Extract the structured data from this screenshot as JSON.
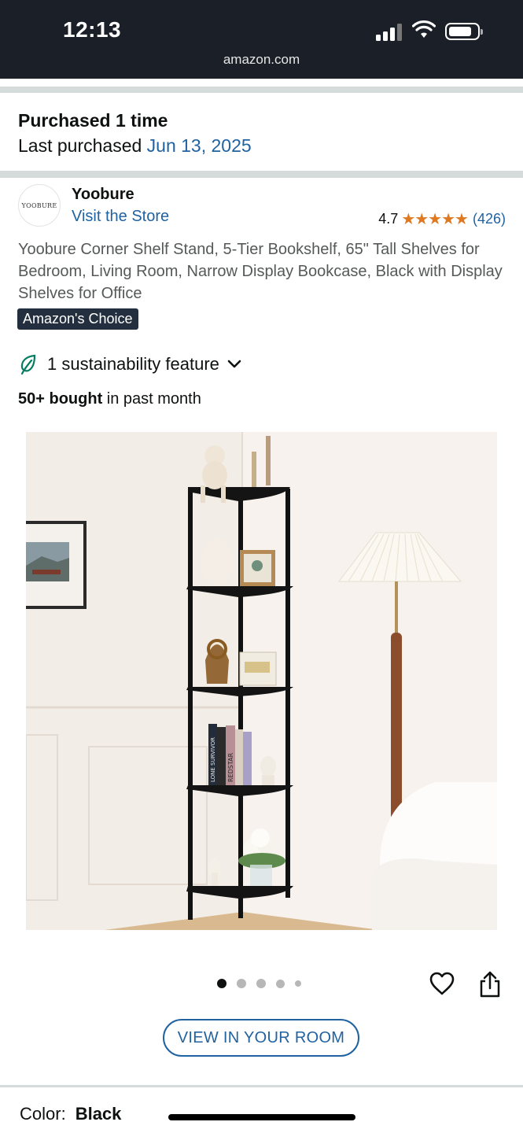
{
  "status_bar": {
    "time": "12:13",
    "url": "amazon.com"
  },
  "purchase": {
    "title": "Purchased 1 time",
    "last_label": "Last purchased ",
    "last_date": "Jun 13, 2025"
  },
  "brand": {
    "logo_text": "YOOBURE",
    "name": "Yoobure",
    "visit_store": "Visit the Store"
  },
  "rating": {
    "value": "4.7",
    "stars": 4.7,
    "stars_glyphs": "★★★★★",
    "count": "(426)"
  },
  "product": {
    "title": "Yoobure Corner Shelf Stand, 5-Tier Bookshelf, 65\" Tall Shelves for Bedroom, Living Room, Narrow Display Bookcase, Black with Display Shelves for Office",
    "badge": "Amazon's Choice"
  },
  "sustainability": {
    "label": "1 sustainability feature"
  },
  "bought": {
    "bold": "50+ bought",
    "rest": " in past month"
  },
  "image": {
    "book_titles": [
      "LONE SURVIVOR",
      "REDSTAR"
    ],
    "pager_total": 5,
    "pager_active": 0
  },
  "actions": {
    "view_in_room": "VIEW IN YOUR ROOM"
  },
  "color": {
    "label": "Color:",
    "value": "Black"
  },
  "colors": {
    "status_bg": "#1b1f27",
    "link": "#2162a1",
    "star": "#de7921",
    "badge_bg": "#232f3e",
    "leaf": "#067d62"
  },
  "icons": [
    "signal-icon",
    "wifi-icon",
    "battery-icon",
    "leaf-icon",
    "chevron-down-icon",
    "heart-icon",
    "share-icon"
  ]
}
